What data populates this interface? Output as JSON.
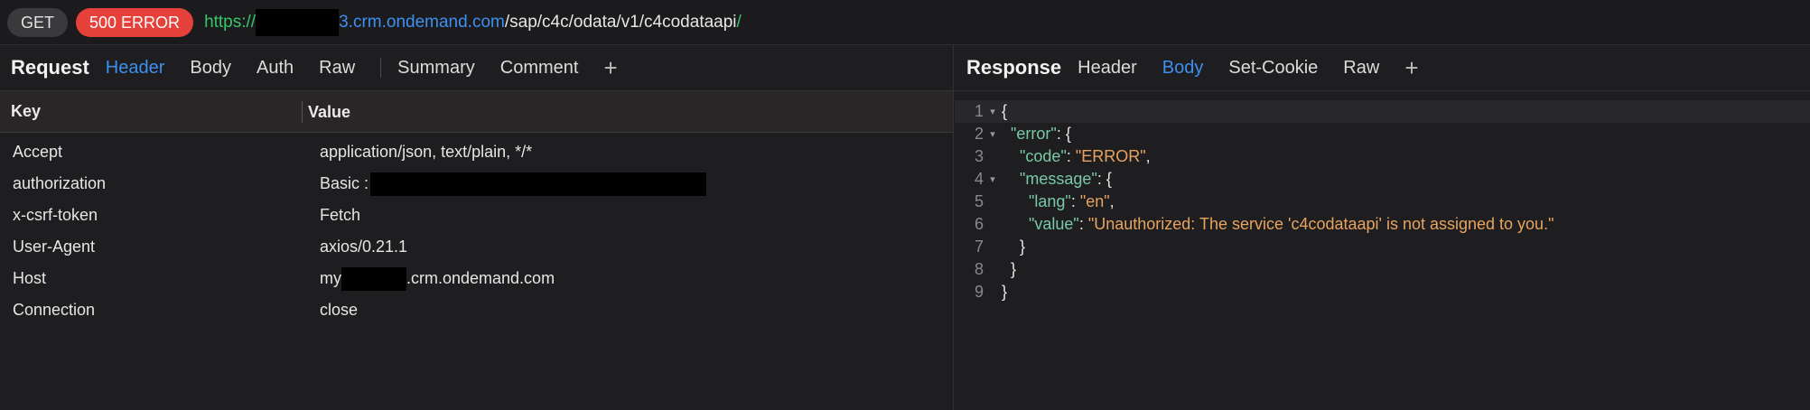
{
  "urlbar": {
    "method": "GET",
    "status": "500 ERROR",
    "url_scheme": "https://",
    "url_host": "3.crm.ondemand.com",
    "url_path": "/sap/c4c/odata/v1/c4codataapi",
    "url_trailing": "/"
  },
  "request": {
    "title": "Request",
    "tabs": [
      "Header",
      "Body",
      "Auth",
      "Raw",
      "Summary",
      "Comment"
    ],
    "active_tab": "Header",
    "columns": {
      "key": "Key",
      "value": "Value"
    },
    "rows": [
      {
        "key": "Accept",
        "value": "application/json, text/plain, */*"
      },
      {
        "key": "authorization",
        "value": "Basic :"
      },
      {
        "key": "x-csrf-token",
        "value": "Fetch"
      },
      {
        "key": "User-Agent",
        "value": "axios/0.21.1"
      },
      {
        "key": "Host",
        "value_prefix": "my",
        "value_suffix": ".crm.ondemand.com"
      },
      {
        "key": "Connection",
        "value": "close"
      }
    ]
  },
  "response": {
    "title": "Response",
    "tabs": [
      "Header",
      "Body",
      "Set-Cookie",
      "Raw"
    ],
    "active_tab": "Body",
    "code_lines": [
      {
        "n": "1",
        "fold": true,
        "indent": "",
        "key": "",
        "sep": "",
        "value": "",
        "close": "{"
      },
      {
        "n": "2",
        "fold": true,
        "indent": "  ",
        "key": "\"error\"",
        "sep": ": ",
        "value": "",
        "close": "{"
      },
      {
        "n": "3",
        "fold": false,
        "indent": "    ",
        "key": "\"code\"",
        "sep": ": ",
        "value": "\"ERROR\"",
        "close": ","
      },
      {
        "n": "4",
        "fold": true,
        "indent": "    ",
        "key": "\"message\"",
        "sep": ": ",
        "value": "",
        "close": "{"
      },
      {
        "n": "5",
        "fold": false,
        "indent": "      ",
        "key": "\"lang\"",
        "sep": ": ",
        "value": "\"en\"",
        "close": ","
      },
      {
        "n": "6",
        "fold": false,
        "indent": "      ",
        "key": "\"value\"",
        "sep": ": ",
        "value": "\"Unauthorized: The service 'c4codataapi' is not assigned to you.\"",
        "close": ""
      },
      {
        "n": "7",
        "fold": false,
        "indent": "    ",
        "key": "",
        "sep": "",
        "value": "",
        "close": "}"
      },
      {
        "n": "8",
        "fold": false,
        "indent": "  ",
        "key": "",
        "sep": "",
        "value": "",
        "close": "}"
      },
      {
        "n": "9",
        "fold": false,
        "indent": "",
        "key": "",
        "sep": "",
        "value": "",
        "close": "}"
      }
    ]
  },
  "icons": {
    "add_tab": "plus-icon",
    "fold": "caret-down-icon"
  },
  "colors": {
    "accent": "#3d8ff0",
    "error_badge": "#e5403a",
    "scheme_green": "#37c66a",
    "json_key": "#79c9a6",
    "json_string": "#e8a35e"
  }
}
